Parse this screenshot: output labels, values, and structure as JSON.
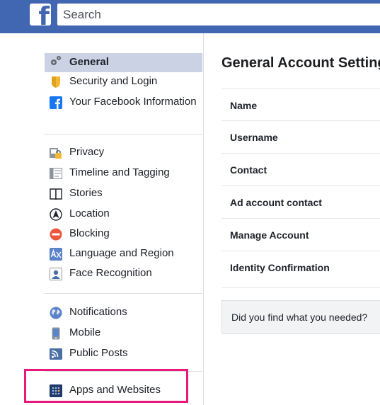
{
  "header": {
    "logo_letter": "f",
    "search": {
      "placeholder": "Search",
      "value": ""
    }
  },
  "sidebar": {
    "groups": [
      [
        {
          "label": "General",
          "icon": "gears-icon",
          "active": true
        },
        {
          "label": "Security and Login",
          "icon": "security-badge-icon"
        },
        {
          "label": "Your Facebook Information",
          "icon": "facebook-icon"
        }
      ],
      [
        {
          "label": "Privacy",
          "icon": "privacy-lock-icon"
        },
        {
          "label": "Timeline and Tagging",
          "icon": "timeline-icon"
        },
        {
          "label": "Stories",
          "icon": "book-icon"
        },
        {
          "label": "Location",
          "icon": "location-icon"
        },
        {
          "label": "Blocking",
          "icon": "blocking-icon"
        },
        {
          "label": "Language and Region",
          "icon": "language-icon"
        },
        {
          "label": "Face Recognition",
          "icon": "face-recognition-icon"
        }
      ],
      [
        {
          "label": "Notifications",
          "icon": "globe-icon"
        },
        {
          "label": "Mobile",
          "icon": "mobile-icon"
        },
        {
          "label": "Public Posts",
          "icon": "rss-icon"
        }
      ],
      [
        {
          "label": "Apps and Websites",
          "icon": "apps-icon"
        }
      ]
    ]
  },
  "main": {
    "title": "General Account Settings",
    "rows": [
      {
        "label": "Name"
      },
      {
        "label": "Username"
      },
      {
        "label": "Contact"
      },
      {
        "label": "Ad account contact"
      },
      {
        "label": "Manage Account"
      },
      {
        "label": "Identity Confirmation"
      }
    ],
    "feedback": "Did you find what you needed?"
  },
  "colors": {
    "brand": "#4267b2",
    "active_item_bg": "#cad2e3",
    "highlight_border": "#e8197a"
  }
}
